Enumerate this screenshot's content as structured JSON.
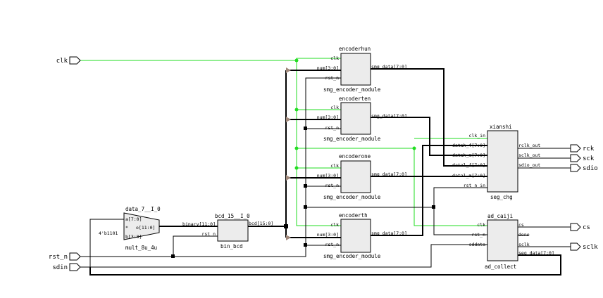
{
  "ports": {
    "clk": "clk",
    "rst_n": "rst_n",
    "sdin": "sdin",
    "rck": "rck",
    "sck": "sck",
    "sdio": "sdio",
    "cs": "cs",
    "sclk": "sclk"
  },
  "mult": {
    "instance": "data_7__I_0",
    "module": "mult_8u_4u",
    "pin_a": "a[7:0]",
    "pin_b": "b[3:0]",
    "pin_o": "o[11:0]",
    "op": "*",
    "const": "4'b1101"
  },
  "bcd": {
    "instance": "bcd_15__I_0",
    "module": "bin_bcd",
    "pin_binary": "binary[11:0]",
    "pin_rst": "rst_n",
    "pin_bcd": "bcd[15:0]"
  },
  "encoders": [
    {
      "instance": "encoderhun",
      "module": "smg_encoder_module",
      "clk": "clk",
      "num": "num[3:0]",
      "rst": "rst_n",
      "out": "smg_data[7:0]"
    },
    {
      "instance": "encoderten",
      "module": "smg_encoder_module",
      "clk": "clk",
      "num": "num[3:0]",
      "rst": "rst_n",
      "out": "smg_data[7:0]"
    },
    {
      "instance": "encoderone",
      "module": "smg_encoder_module",
      "clk": "clk",
      "num": "num[3:0]",
      "rst": "rst_n",
      "out": "smg_data[7:0]"
    },
    {
      "instance": "encoderth",
      "module": "smg_encoder_module",
      "clk": "clk",
      "num": "num[3:0]",
      "rst": "rst_n",
      "out": "smg_data[7:0]"
    }
  ],
  "xianshi": {
    "instance": "xianshi",
    "module": "seg_chg",
    "pins_in": [
      "clk_in",
      "datah_f[7:0]",
      "datah_m[7:0]",
      "datal_f[7:0]",
      "datal_m[7:0]",
      "rst_n_in"
    ],
    "pins_out": [
      "rclk_out",
      "sclk_out",
      "sdio_out"
    ]
  },
  "adc": {
    "instance": "ad_caiji",
    "module": "ad_collect",
    "pins_in": [
      "clk",
      "rst_n",
      "sddata"
    ],
    "pins_out": [
      "cs",
      "done",
      "sclk",
      "seg_data[7:0]"
    ]
  }
}
